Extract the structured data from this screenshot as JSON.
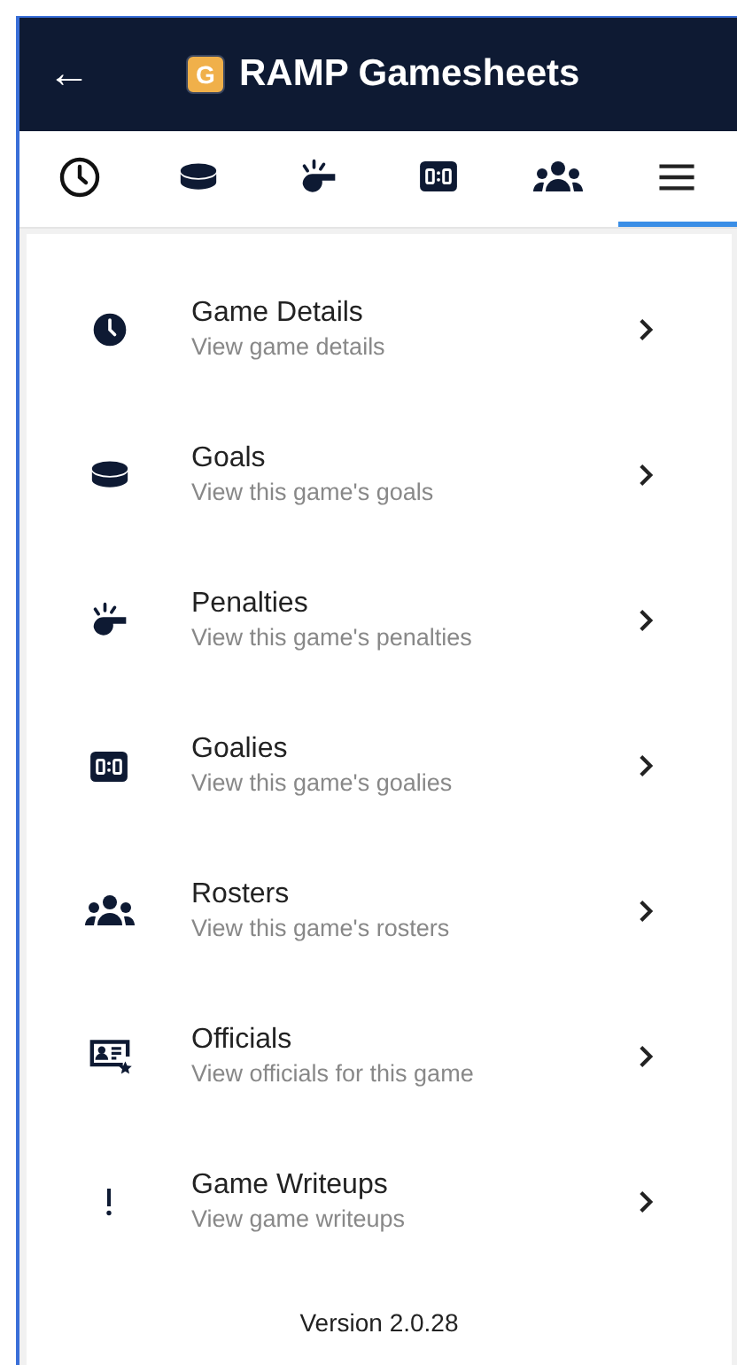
{
  "app_bar": {
    "back": "←",
    "title": "RAMP Gamesheets",
    "logo_letter": "G"
  },
  "tabs": [
    {
      "selected": false
    },
    {
      "selected": false
    },
    {
      "selected": false
    },
    {
      "selected": false
    },
    {
      "selected": false
    },
    {
      "selected": true
    }
  ],
  "menu_items": [
    {
      "title": "Game Details",
      "subtitle": "View game details"
    },
    {
      "title": "Goals",
      "subtitle": "View this game's goals"
    },
    {
      "title": "Penalties",
      "subtitle": "View this game's penalties"
    },
    {
      "title": "Goalies",
      "subtitle": "View this game's goalies"
    },
    {
      "title": "Rosters",
      "subtitle": "View this game's rosters"
    },
    {
      "title": "Officials",
      "subtitle": "View officials for this game"
    },
    {
      "title": "Game Writeups",
      "subtitle": "View game writeups"
    }
  ],
  "version": "Version 2.0.28"
}
